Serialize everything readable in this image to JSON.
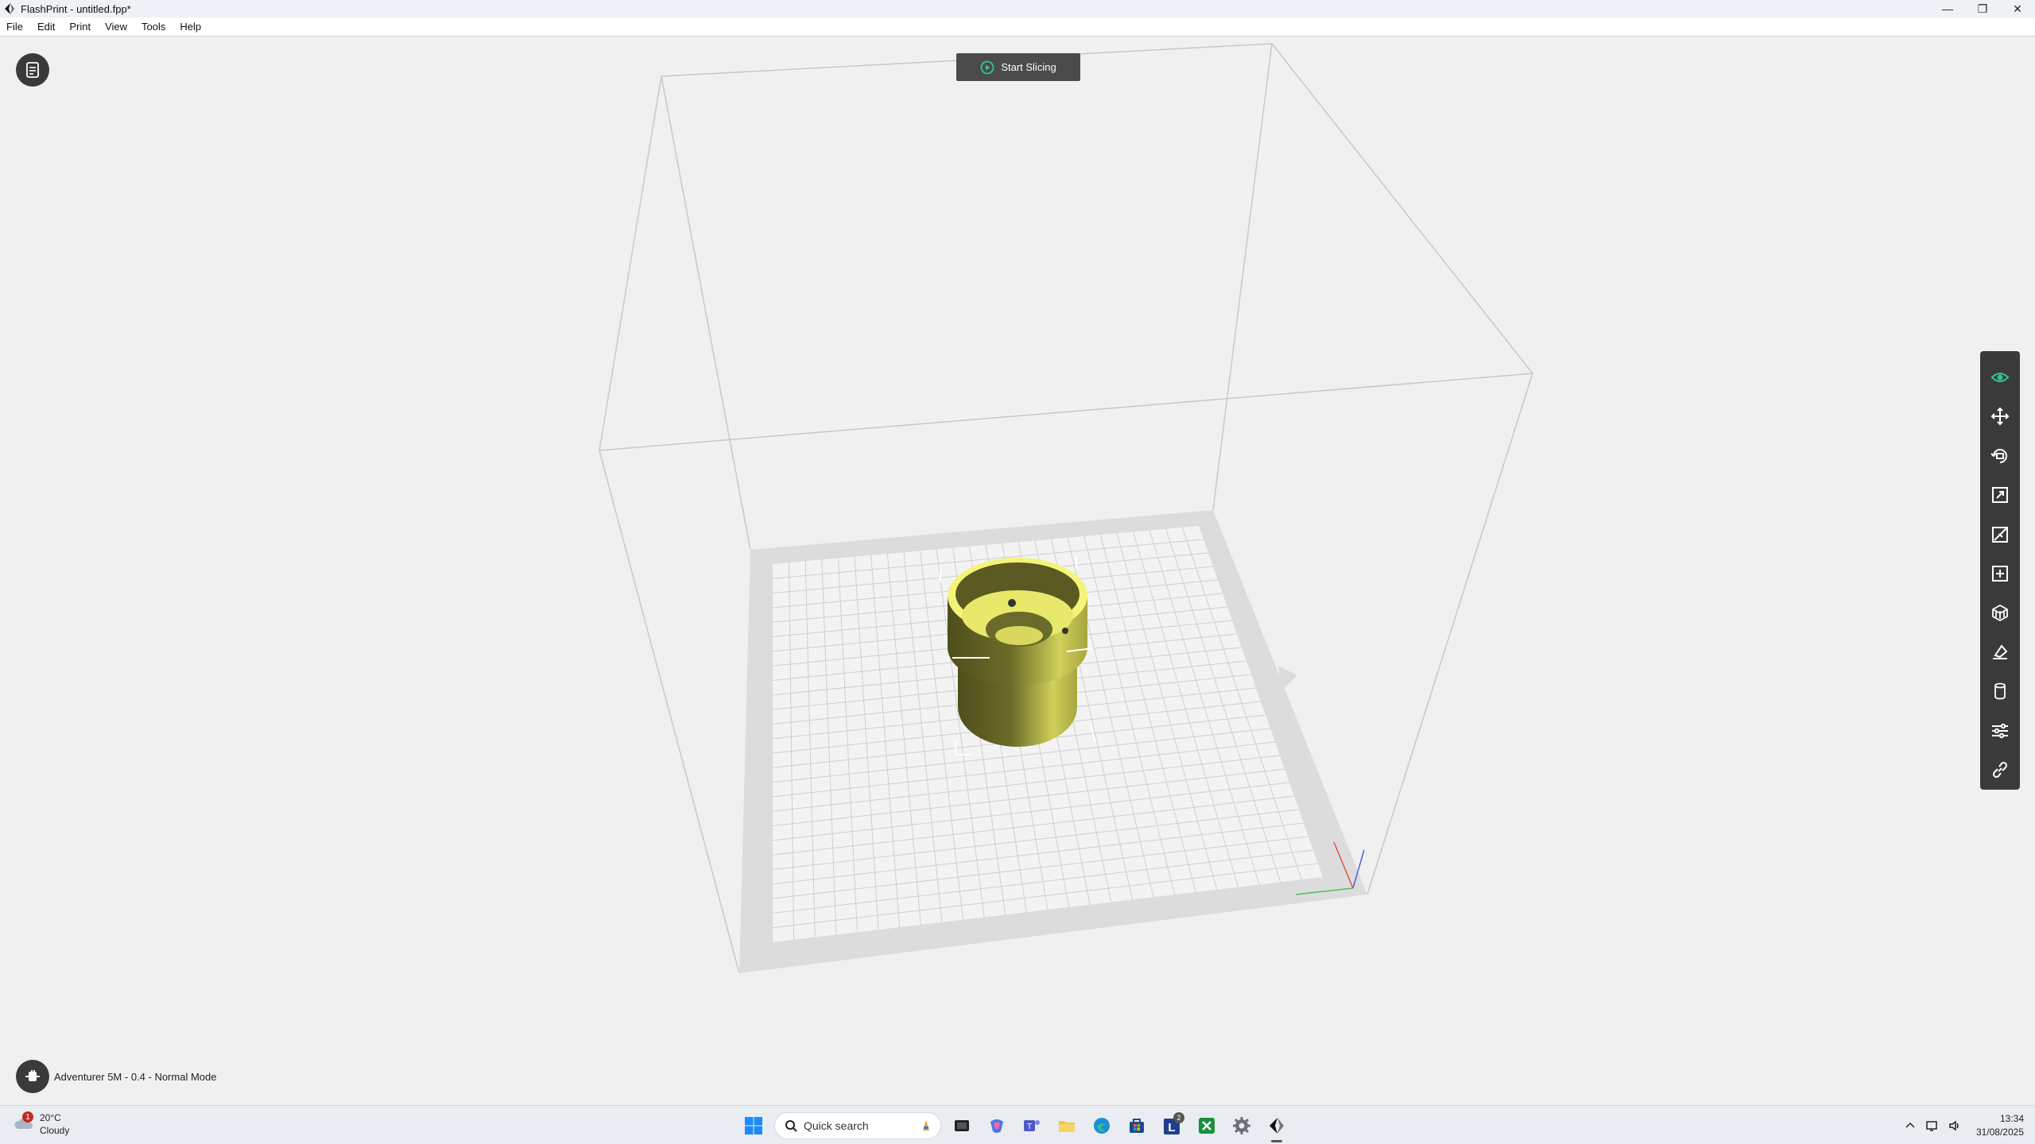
{
  "window": {
    "title": "FlashPrint - untitled.fpp*",
    "minimize": "—",
    "restore": "❐",
    "close": "✕"
  },
  "menu": [
    "File",
    "Edit",
    "Print",
    "View",
    "Tools",
    "Help"
  ],
  "viewport": {
    "slice_button": "Start Slicing",
    "printer_label": "Adventurer 5M - 0.4 - Normal Mode",
    "model_color": "#e8e86a",
    "accent_color": "#2ec98c"
  },
  "right_toolbar": [
    {
      "name": "view-icon"
    },
    {
      "name": "move-icon"
    },
    {
      "name": "rotate-icon"
    },
    {
      "name": "scale-icon"
    },
    {
      "name": "cut-icon"
    },
    {
      "name": "add-object-icon"
    },
    {
      "name": "supports-icon"
    },
    {
      "name": "lay-flat-icon"
    },
    {
      "name": "cylinder-icon"
    },
    {
      "name": "settings-sliders-icon"
    },
    {
      "name": "link-icon"
    }
  ],
  "taskbar": {
    "weather_temp": "20°C",
    "weather_desc": "Cloudy",
    "weather_badge": "1",
    "search_placeholder": "Quick search",
    "teams_count": "2",
    "time": "13:34",
    "date": "31/08/2025"
  }
}
